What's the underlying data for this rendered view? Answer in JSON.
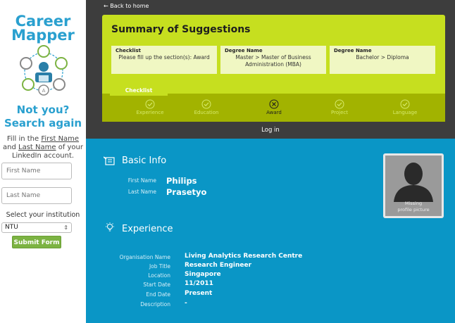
{
  "sidebar": {
    "brand_line1": "Career",
    "brand_line2": "Mapper",
    "not_you_line1": "Not you?",
    "not_you_line2": "Search again",
    "hint_part1": "Fill in the ",
    "hint_first_name": "First Name",
    "hint_and": " and ",
    "hint_last_name": "Last Name",
    "hint_part2": " of your LinkedIn account.",
    "first_name_placeholder": "First Name",
    "last_name_placeholder": "Last Name",
    "institution_label": "Select your institution",
    "institution_value": "NTU",
    "submit_label": "Submit Form"
  },
  "header": {
    "back_link": "← Back to home",
    "summary_title": "Summary of Suggestions",
    "cards": [
      {
        "title": "Checklist",
        "value": "Please fill up the section(s): Award"
      },
      {
        "title": "Degree Name",
        "value": "Master > Master of Business Administration (MBA)"
      },
      {
        "title": "Degree Name",
        "value": "Bachelor > Diploma"
      }
    ],
    "checklist_tab": "Checklist",
    "steps": [
      {
        "label": "Experience",
        "status": "done"
      },
      {
        "label": "Education",
        "status": "done"
      },
      {
        "label": "Award",
        "status": "missing"
      },
      {
        "label": "Project",
        "status": "done"
      },
      {
        "label": "Language",
        "status": "done"
      }
    ],
    "login": "Log in"
  },
  "basic_info": {
    "title": "Basic Info",
    "first_name_label": "First Name",
    "first_name": "Philips",
    "last_name_label": "Last Name",
    "last_name": "Prasetyo",
    "photo_caption_line1": "Missing",
    "photo_caption_line2": "profile picture"
  },
  "experience": {
    "title": "Experience",
    "fields": [
      {
        "label": "Organisation Name",
        "value": "Living Analytics Research Centre"
      },
      {
        "label": "Job Title",
        "value": "Research Engineer"
      },
      {
        "label": "Location",
        "value": "Singapore"
      },
      {
        "label": "Start Date",
        "value": "11/2011"
      },
      {
        "label": "End Date",
        "value": "Present"
      },
      {
        "label": "Description",
        "value": "-"
      }
    ]
  },
  "colors": {
    "brand": "#2aa0cf",
    "lime": "#c6df1f",
    "lime_dark": "#a2b300",
    "blue": "#0a96c6",
    "dark": "#3d3d3d",
    "submit": "#7cb342"
  }
}
